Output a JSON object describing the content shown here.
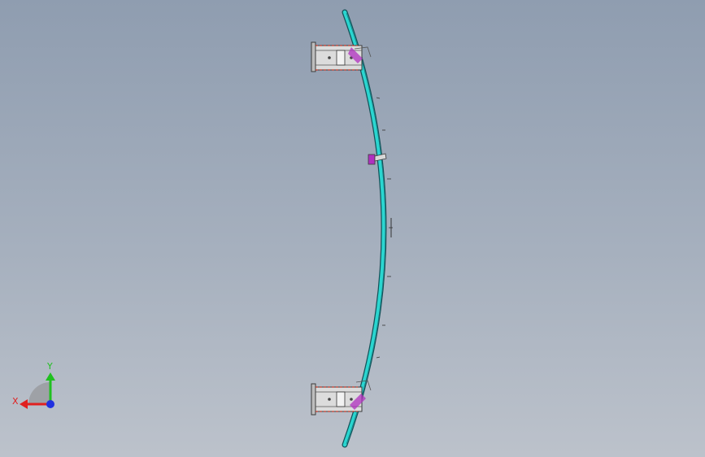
{
  "viewport": {
    "background_top": "#8f9db0",
    "background_bottom": "#bcc2cb"
  },
  "model": {
    "rail_color": "#2ad6d0",
    "rail_outline": "#14535a",
    "bracket_color": "#d8d8d8",
    "bracket_outline": "#3a3a3a",
    "hidden_edge_color": "#c0392b",
    "accent_color": "#b030c0"
  },
  "triad": {
    "x_label": "X",
    "y_label": "Y",
    "x_color": "#e02020",
    "y_color": "#20c020",
    "z_color": "#2030e0"
  }
}
